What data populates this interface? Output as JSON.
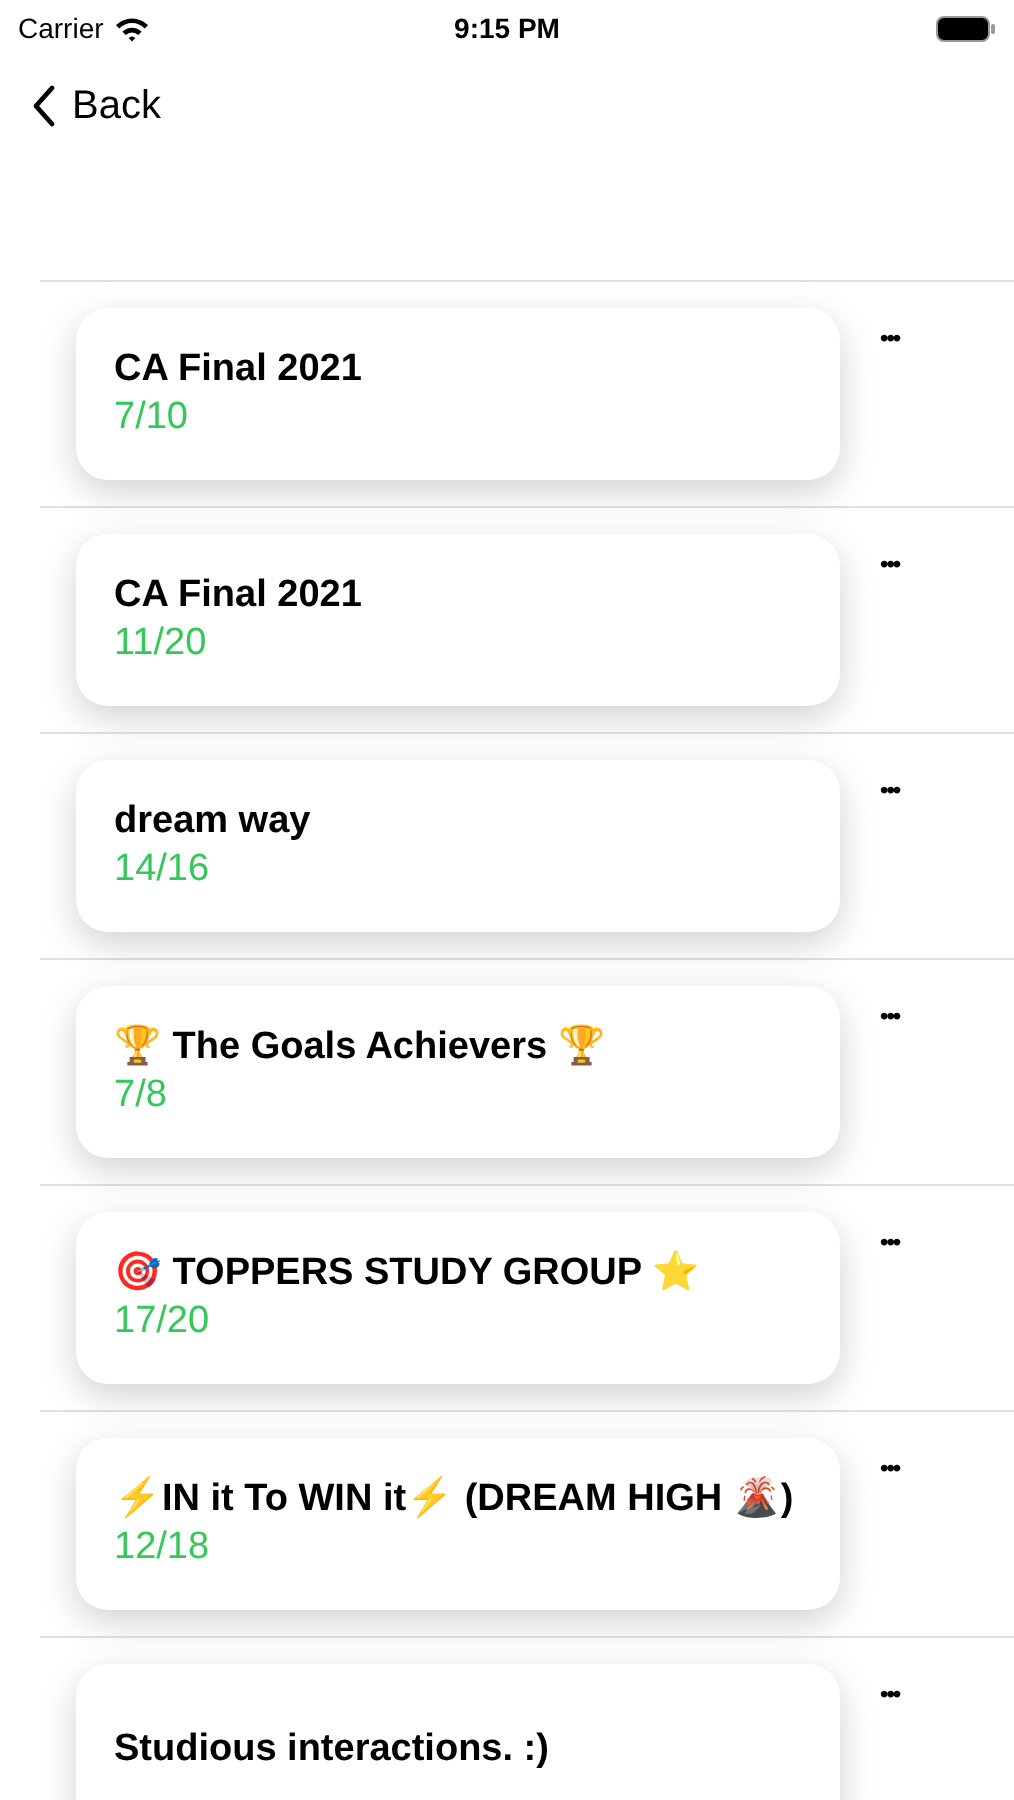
{
  "status_bar": {
    "carrier": "Carrier",
    "time": "9:15 PM"
  },
  "nav": {
    "back_label": "Back"
  },
  "groups": [
    {
      "name": "CA Final 2021",
      "score": "7/10",
      "menu": "•••"
    },
    {
      "name": "CA Final 2021",
      "score": "11/20",
      "menu": "•••"
    },
    {
      "name": "dream way",
      "score": "14/16",
      "menu": "•••"
    },
    {
      "name": "🏆 The Goals Achievers 🏆",
      "score": "7/8",
      "menu": "•••"
    },
    {
      "name": "🎯 TOPPERS STUDY GROUP ⭐",
      "score": "17/20",
      "menu": "•••"
    },
    {
      "name": "⚡IN it To WIN it⚡  (DREAM HIGH 🌋)",
      "score": "12/18",
      "menu": "•••"
    },
    {
      "name": "Studious interactions. :)",
      "menu": "•••"
    }
  ]
}
